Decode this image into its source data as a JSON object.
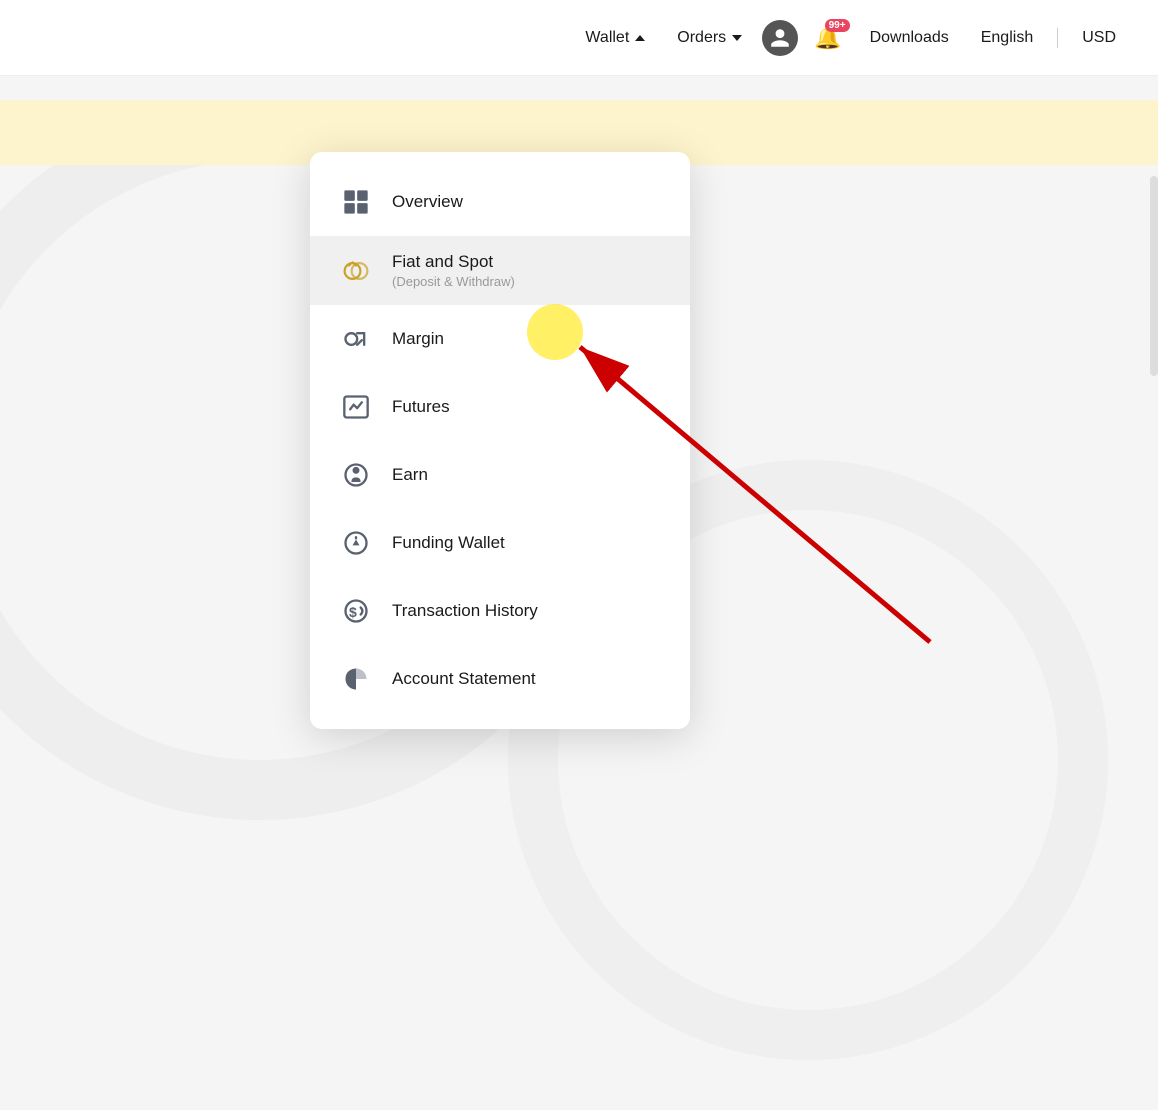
{
  "navbar": {
    "wallet_label": "Wallet",
    "orders_label": "Orders",
    "downloads_label": "Downloads",
    "english_label": "English",
    "usd_label": "USD",
    "bell_badge": "99+"
  },
  "menu": {
    "items": [
      {
        "id": "overview",
        "label": "Overview",
        "sublabel": "",
        "icon": "grid"
      },
      {
        "id": "fiat-spot",
        "label": "Fiat and Spot",
        "sublabel": "(Deposit & Withdraw)",
        "icon": "fiat",
        "active": true
      },
      {
        "id": "margin",
        "label": "Margin",
        "sublabel": "",
        "icon": "margin"
      },
      {
        "id": "futures",
        "label": "Futures",
        "sublabel": "",
        "icon": "futures"
      },
      {
        "id": "earn",
        "label": "Earn",
        "sublabel": "",
        "icon": "earn"
      },
      {
        "id": "funding-wallet",
        "label": "Funding Wallet",
        "sublabel": "",
        "icon": "funding"
      },
      {
        "id": "transaction-history",
        "label": "Transaction History",
        "sublabel": "",
        "icon": "transaction"
      },
      {
        "id": "account-statement",
        "label": "Account Statement",
        "sublabel": "",
        "icon": "statement"
      }
    ]
  }
}
